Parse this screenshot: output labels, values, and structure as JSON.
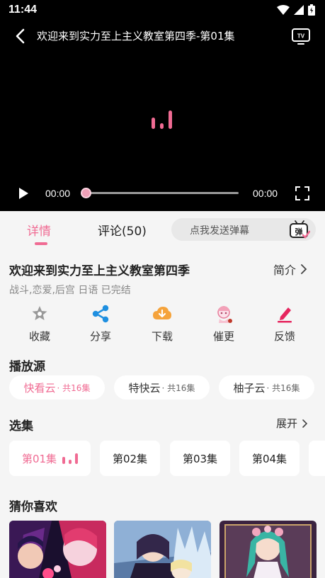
{
  "status": {
    "time": "11:44"
  },
  "player": {
    "title": "欢迎来到实力至上主义教室第四季-第01集",
    "current_time": "00:00",
    "total_time": "00:00",
    "progress": 0
  },
  "tabs": {
    "details": "详情",
    "comments": "评论(50)"
  },
  "danmaku": {
    "placeholder": "点我发送弹幕",
    "icon_label": "弹"
  },
  "anime": {
    "title": "欢迎来到实力至上主义教室第四季",
    "intro_label": "简介",
    "tags": "战斗,恋爱,后宫 日语 已完结"
  },
  "actions": [
    {
      "label": "收藏",
      "icon": "star-icon"
    },
    {
      "label": "分享",
      "icon": "share-icon"
    },
    {
      "label": "下载",
      "icon": "download-cloud-icon"
    },
    {
      "label": "催更",
      "icon": "mascot-icon"
    },
    {
      "label": "反馈",
      "icon": "edit-pen-icon"
    }
  ],
  "sources": {
    "title": "播放源",
    "items": [
      {
        "name": "快看云",
        "count": "· 共16集"
      },
      {
        "name": "特快云",
        "count": "· 共16集"
      },
      {
        "name": "柚子云",
        "count": "· 共16集"
      }
    ]
  },
  "episodes": {
    "title": "选集",
    "expand_label": "展开",
    "items": [
      "第01集",
      "第02集",
      "第03集",
      "第04集"
    ]
  },
  "recommend": {
    "title": "猜你喜欢"
  },
  "colors": {
    "accent": "#f06b93",
    "player_bg": "#000000",
    "page_bg": "#f5f5f5"
  }
}
